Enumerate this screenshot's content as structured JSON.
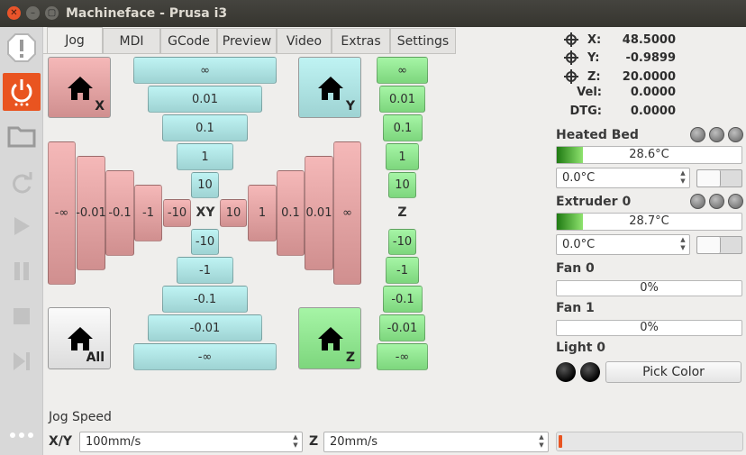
{
  "window": {
    "title": "Machineface - Prusa i3"
  },
  "sidebar": {
    "items": [
      {
        "name": "estop-icon"
      },
      {
        "name": "power-icon"
      },
      {
        "name": "folder-icon"
      },
      {
        "name": "refresh-icon"
      },
      {
        "name": "play-icon"
      },
      {
        "name": "pause-icon"
      },
      {
        "name": "stop-icon"
      },
      {
        "name": "step-icon"
      },
      {
        "name": "more-icon"
      }
    ]
  },
  "tabs": [
    {
      "label": "Jog",
      "active": true
    },
    {
      "label": "MDI"
    },
    {
      "label": "GCode"
    },
    {
      "label": "Preview"
    },
    {
      "label": "Video"
    },
    {
      "label": "Extras"
    },
    {
      "label": "Settings"
    }
  ],
  "jog": {
    "home_x": "X",
    "home_y": "Y",
    "home_all": "All",
    "home_z": "Z",
    "y_up": [
      "∞",
      "0.01",
      "0.1",
      "1",
      "10"
    ],
    "y_down": [
      "-10",
      "-1",
      "-0.1",
      "-0.01",
      "-∞"
    ],
    "x_neg": [
      "-∞",
      "-0.01",
      "-0.1",
      "-1",
      "-10"
    ],
    "x_pos": [
      "10",
      "1",
      "0.1",
      "0.01",
      "∞"
    ],
    "xy_label": "XY",
    "z_up": [
      "∞",
      "0.01",
      "0.1",
      "1",
      "10"
    ],
    "z_down": [
      "-10",
      "-1",
      "-0.1",
      "-0.01",
      "-∞"
    ],
    "z_label": "Z",
    "speed_label": "Jog Speed",
    "xy_speed_label": "X/Y",
    "xy_speed": "100mm/s",
    "z_speed_label": "Z",
    "z_speed": "20mm/s"
  },
  "position": {
    "x_label": "X:",
    "x": "48.5000",
    "y_label": "Y:",
    "y": "-0.9899",
    "z_label": "Z:",
    "z": "20.0000",
    "vel_label": "Vel:",
    "vel": "0.0000",
    "dtg_label": "DTG:",
    "dtg": "0.0000"
  },
  "heated_bed": {
    "label": "Heated Bed",
    "temp": "28.6°C",
    "fill": 0.14,
    "setpoint": "0.0°C"
  },
  "extruder": {
    "label": "Extruder 0",
    "temp": "28.7°C",
    "fill": 0.14,
    "setpoint": "0.0°C"
  },
  "fan0": {
    "label": "Fan 0",
    "value": "0%"
  },
  "fan1": {
    "label": "Fan 1",
    "value": "0%"
  },
  "light": {
    "label": "Light 0",
    "button": "Pick Color"
  },
  "colors": {
    "accent": "#e95420",
    "teal": "#a9e3e3",
    "pink": "#e6a5a5",
    "green": "#8fe68f"
  }
}
